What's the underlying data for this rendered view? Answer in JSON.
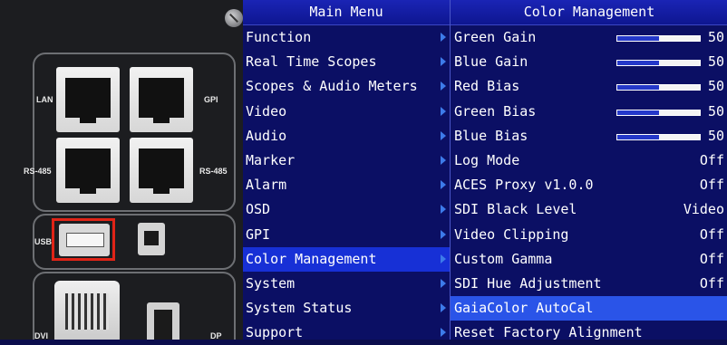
{
  "hardware_labels": {
    "lan": "LAN",
    "gpi": "GPI",
    "rs485_left": "RS-485",
    "rs485_right": "RS-485",
    "usb": "USB",
    "dvi": "DVI",
    "dp": "DP"
  },
  "main_menu": {
    "title": "Main Menu",
    "items": [
      {
        "label": "Function"
      },
      {
        "label": "Real Time Scopes"
      },
      {
        "label": "Scopes & Audio Meters"
      },
      {
        "label": "Video"
      },
      {
        "label": "Audio"
      },
      {
        "label": "Marker"
      },
      {
        "label": "Alarm"
      },
      {
        "label": "OSD"
      },
      {
        "label": "GPI"
      },
      {
        "label": "Color Management",
        "selected": true
      },
      {
        "label": "System"
      },
      {
        "label": "System Status"
      },
      {
        "label": "Support"
      }
    ]
  },
  "color_management": {
    "title": "Color Management",
    "items": [
      {
        "label": "Green Gain",
        "value": "50",
        "slider_fraction": 0.5
      },
      {
        "label": "Blue Gain",
        "value": "50",
        "slider_fraction": 0.5
      },
      {
        "label": "Red Bias",
        "value": "50",
        "slider_fraction": 0.5
      },
      {
        "label": "Green Bias",
        "value": "50",
        "slider_fraction": 0.5
      },
      {
        "label": "Blue Bias",
        "value": "50",
        "slider_fraction": 0.5
      },
      {
        "label": "Log Mode",
        "value": "Off"
      },
      {
        "label": "ACES Proxy v1.0.0",
        "value": "Off"
      },
      {
        "label": "SDI Black Level",
        "value": "Video"
      },
      {
        "label": "Video Clipping",
        "value": "Off"
      },
      {
        "label": "Custom Gamma",
        "value": "Off"
      },
      {
        "label": "SDI Hue Adjustment",
        "value": "Off"
      },
      {
        "label": "GaiaColor AutoCal",
        "selected": true
      },
      {
        "label": "Reset Factory Alignment"
      }
    ]
  }
}
